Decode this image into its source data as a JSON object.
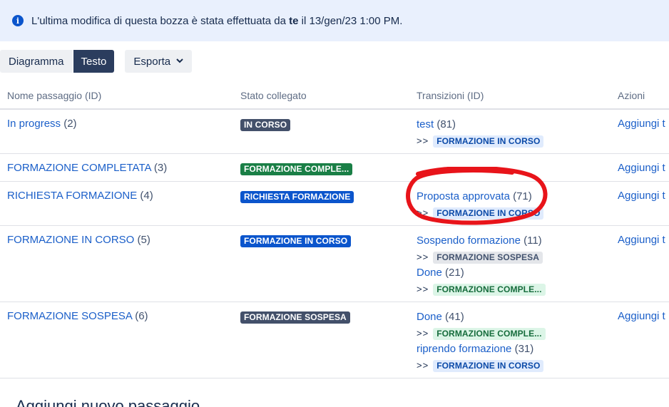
{
  "banner": {
    "text_before": "L'ultima modifica di questa bozza è stata effettuata da ",
    "user": "te",
    "text_after": " il 13/gen/23 1:00 PM."
  },
  "toolbar": {
    "diagram_label": "Diagramma",
    "text_label": "Testo",
    "export_label": "Esporta"
  },
  "table": {
    "headers": {
      "name": "Nome passaggio (ID)",
      "status": "Stato collegato",
      "transitions": "Transizioni (ID)",
      "actions": "Azioni"
    },
    "rows": [
      {
        "name": "In progress",
        "id": "(2)",
        "status": "IN CORSO",
        "action": "Aggiungi t",
        "transitions": [
          {
            "name": "test",
            "id": "(81)",
            "arrow": ">>",
            "target": "FORMAZIONE IN CORSO"
          }
        ]
      },
      {
        "name": "FORMAZIONE COMPLETATA",
        "id": "(3)",
        "status": "FORMAZIONE COMPLE...",
        "action": "Aggiungi t",
        "transitions": []
      },
      {
        "name": "RICHIESTA FORMAZIONE",
        "id": "(4)",
        "status": "RICHIESTA FORMAZIONE",
        "action": "Aggiungi t",
        "transitions": [
          {
            "name": "Proposta approvata",
            "id": "(71)",
            "arrow": ">>",
            "target": "FORMAZIONE IN CORSO"
          }
        ]
      },
      {
        "name": "FORMAZIONE IN CORSO",
        "id": "(5)",
        "status": "FORMAZIONE IN CORSO",
        "action": "Aggiungi t",
        "transitions": [
          {
            "name": "Sospendo formazione",
            "id": "(11)",
            "arrow": ">>",
            "target": "FORMAZIONE SOSPESA"
          },
          {
            "name": "Done",
            "id": "(21)",
            "arrow": ">>",
            "target": "FORMAZIONE COMPLE..."
          }
        ]
      },
      {
        "name": "FORMAZIONE SOSPESA",
        "id": "(6)",
        "status": "FORMAZIONE SOSPESA",
        "action": "Aggiungi t",
        "transitions": [
          {
            "name": "Done",
            "id": "(41)",
            "arrow": ">>",
            "target": "FORMAZIONE COMPLE..."
          },
          {
            "name": "riprendo formazione",
            "id": "(31)",
            "arrow": ">>",
            "target": "FORMAZIONE IN CORSO"
          }
        ]
      }
    ]
  },
  "footer": {
    "title": "Aggiungi nuovo passaggio"
  },
  "colors": {
    "link": "#1b5fc9",
    "annotation": "#e8141a"
  }
}
